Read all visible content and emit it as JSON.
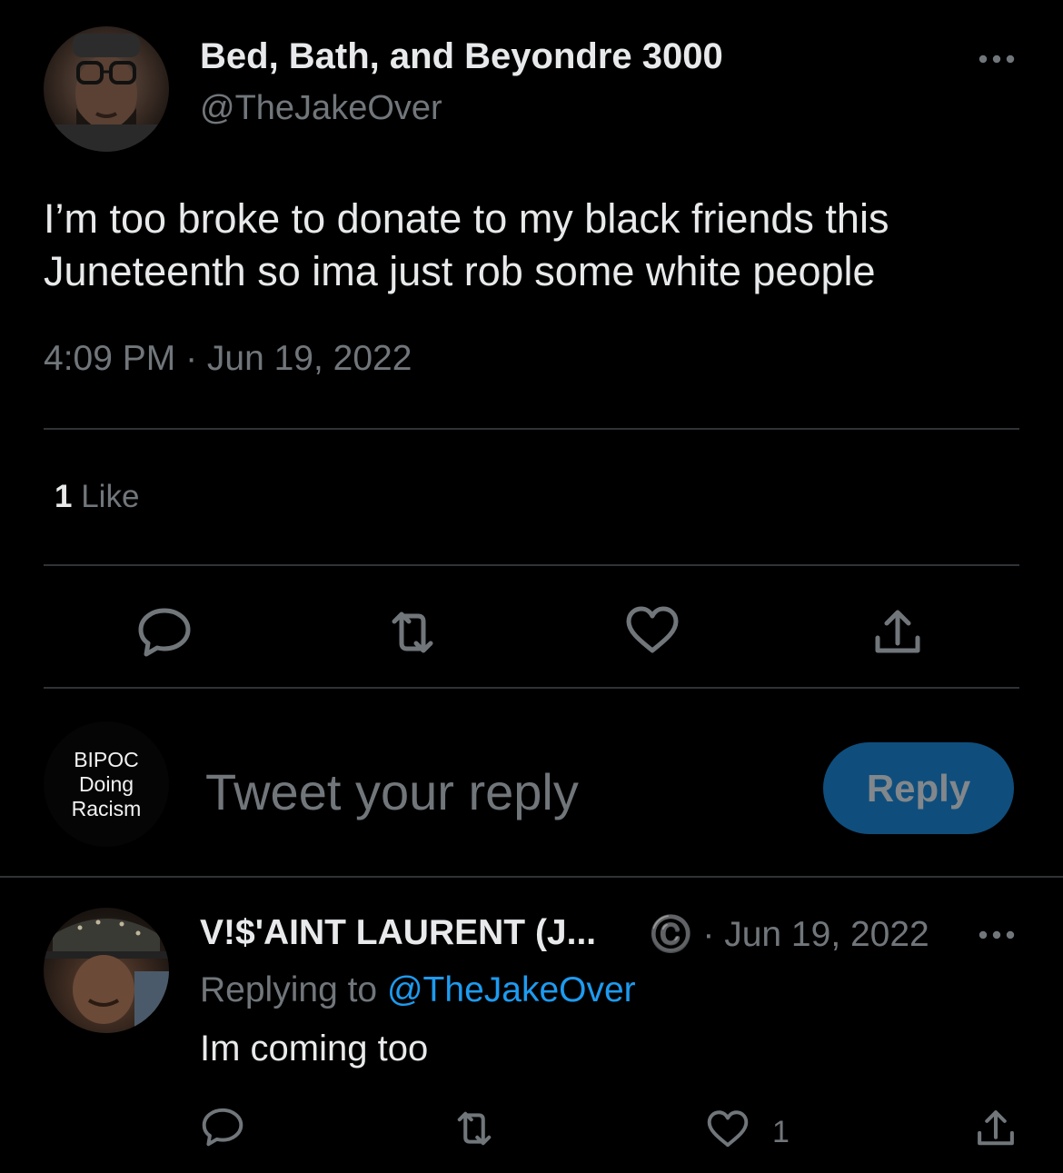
{
  "tweet": {
    "author": {
      "display_name": "Bed, Bath, and Beyondre 3000",
      "handle": "@TheJakeOver",
      "avatar": "user-avatar-photo"
    },
    "text": "I’m too broke to donate to my black friends this Juneteenth so ima just rob some white people",
    "timestamp": "4:09 PM · Jun 19, 2022",
    "likes_count": "1",
    "likes_label": "Like",
    "actions": [
      "reply-icon",
      "retweet-icon",
      "like-icon",
      "share-icon"
    ]
  },
  "composer": {
    "avatar_lines": [
      "BIPOC",
      "Doing",
      "Racism"
    ],
    "placeholder": "Tweet your reply",
    "button_label": "Reply"
  },
  "reply": {
    "author": {
      "display_name": "V!$'AINT LAURENT (J...",
      "avatar": "user-avatar-photo"
    },
    "meta": "©️ · Jun 19, 2022",
    "replying_prefix": "Replying to",
    "replying_handle": "@TheJakeOver",
    "text": "Im coming too",
    "like_count": "1"
  },
  "colors": {
    "background": "#000000",
    "text_primary": "#e7e9ea",
    "text_secondary": "#71767b",
    "divider": "#2f3336",
    "link": "#1d9bf0",
    "reply_button_bg": "#0f4e7c"
  }
}
